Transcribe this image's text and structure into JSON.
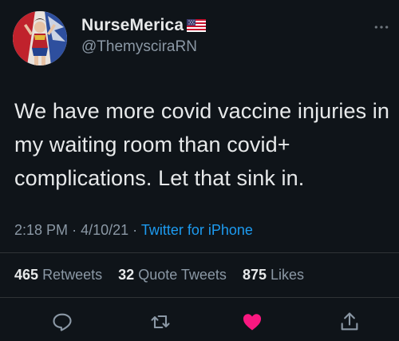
{
  "user": {
    "display_name": "NurseMerica",
    "handle": "@ThemysciraRN"
  },
  "tweet": {
    "text": "We have more covid vaccine injuries in my waiting room than covid+ complications. Let that sink in.",
    "time": "2:18 PM",
    "date": "4/10/21",
    "separator": "·",
    "source": "Twitter for iPhone"
  },
  "stats": {
    "retweets_count": "465",
    "retweets_label": "Retweets",
    "quotes_count": "32",
    "quotes_label": "Quote Tweets",
    "likes_count": "875",
    "likes_label": "Likes"
  },
  "icons": {
    "flag": "us-flag-icon",
    "more": "more-dots-icon",
    "reply": "reply-icon",
    "retweet": "retweet-icon",
    "like": "heart-icon",
    "share": "share-icon"
  },
  "colors": {
    "background": "#0f1419",
    "link": "#1d9bf0",
    "like": "#f91880",
    "muted": "#8b98a5"
  }
}
